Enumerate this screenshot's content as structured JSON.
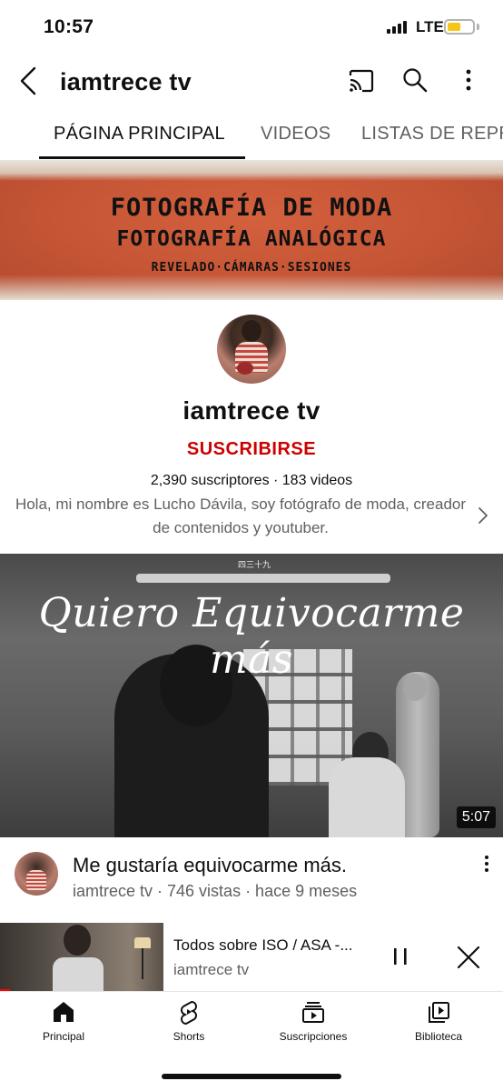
{
  "status": {
    "time": "10:57",
    "network": "LTE"
  },
  "header": {
    "title": "iamtrece tv",
    "icons": [
      "back-icon",
      "cast-icon",
      "search-icon",
      "more-vert-icon"
    ]
  },
  "tabs": [
    {
      "label": "PÁGINA PRINCIPAL",
      "active": true
    },
    {
      "label": "VIDEOS",
      "active": false
    },
    {
      "label": "LISTAS DE REPR",
      "active": false
    }
  ],
  "banner": {
    "line1": "FOTOGRAFÍA DE MODA",
    "line2": "FOTOGRAFÍA ANALÓGICA",
    "line3": "REVELADO·CÁMARAS·SESIONES"
  },
  "channel": {
    "name": "iamtrece tv",
    "subscribe_label": "SUSCRIBIRSE",
    "stats": "2,390 suscriptores · 183 videos",
    "description": "Hola, mi nombre es Lucho Dávila, soy fotógrafo de moda, creador de contenidos y youtuber."
  },
  "featured_video": {
    "overlay_chinese": "四三十九",
    "overlay_title": "Quiero Equivocarme más",
    "duration": "5:07",
    "title": "Me gustaría equivocarme más.",
    "meta": "iamtrece tv · 746 vistas · hace 9 meses"
  },
  "mini_player": {
    "title": "Todos sobre ISO / ASA -...",
    "channel": "iamtrece tv",
    "progress": 0.02
  },
  "bottom_nav": [
    {
      "label": "Principal",
      "icon": "home-icon"
    },
    {
      "label": "Shorts",
      "icon": "shorts-icon"
    },
    {
      "label": "Suscripciones",
      "icon": "subscriptions-icon"
    },
    {
      "label": "Biblioteca",
      "icon": "library-icon"
    }
  ],
  "colors": {
    "subscribe": "#cc0000",
    "battery": "#f5c518",
    "progress": "#ff0000"
  }
}
